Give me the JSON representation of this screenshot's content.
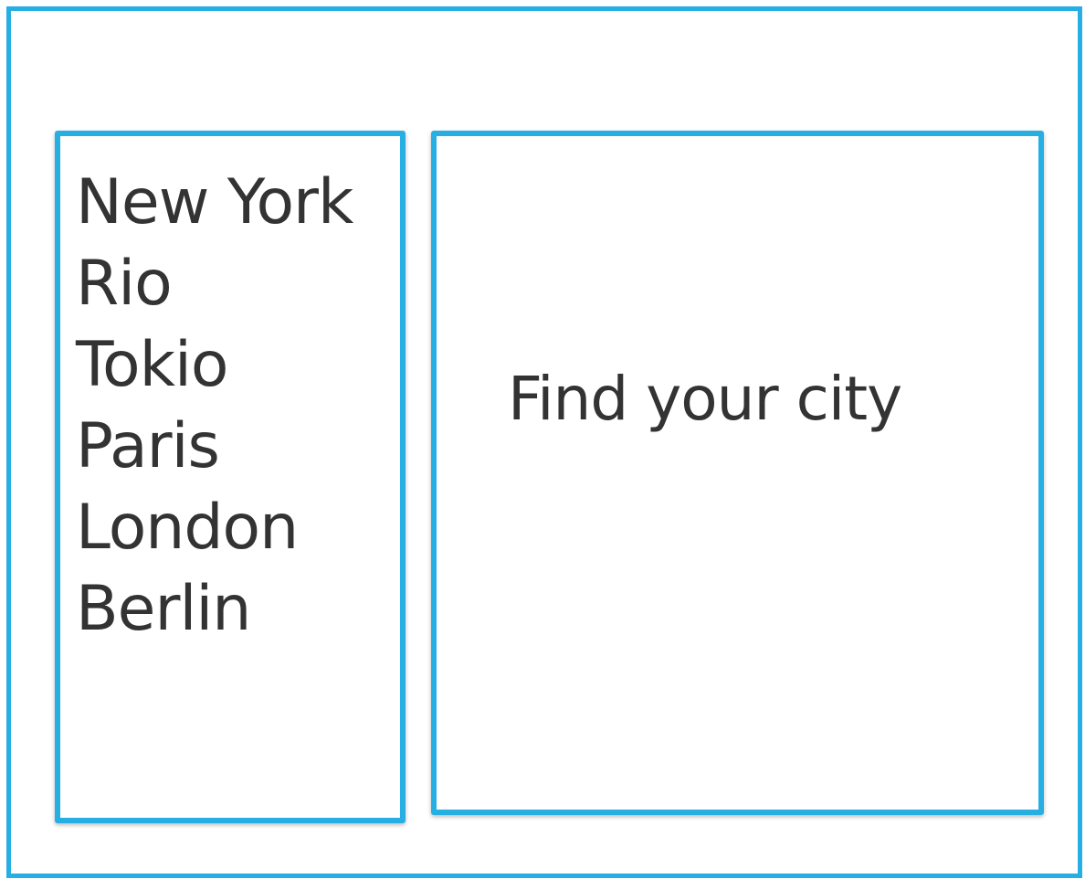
{
  "sidebar": {
    "cities": [
      "New York",
      "Rio",
      "Tokio",
      "Paris",
      "London",
      "Berlin"
    ]
  },
  "main": {
    "prompt": "Find your city"
  },
  "colors": {
    "border_accent": "#27aee3",
    "text": "#333333",
    "background": "#ffffff"
  }
}
